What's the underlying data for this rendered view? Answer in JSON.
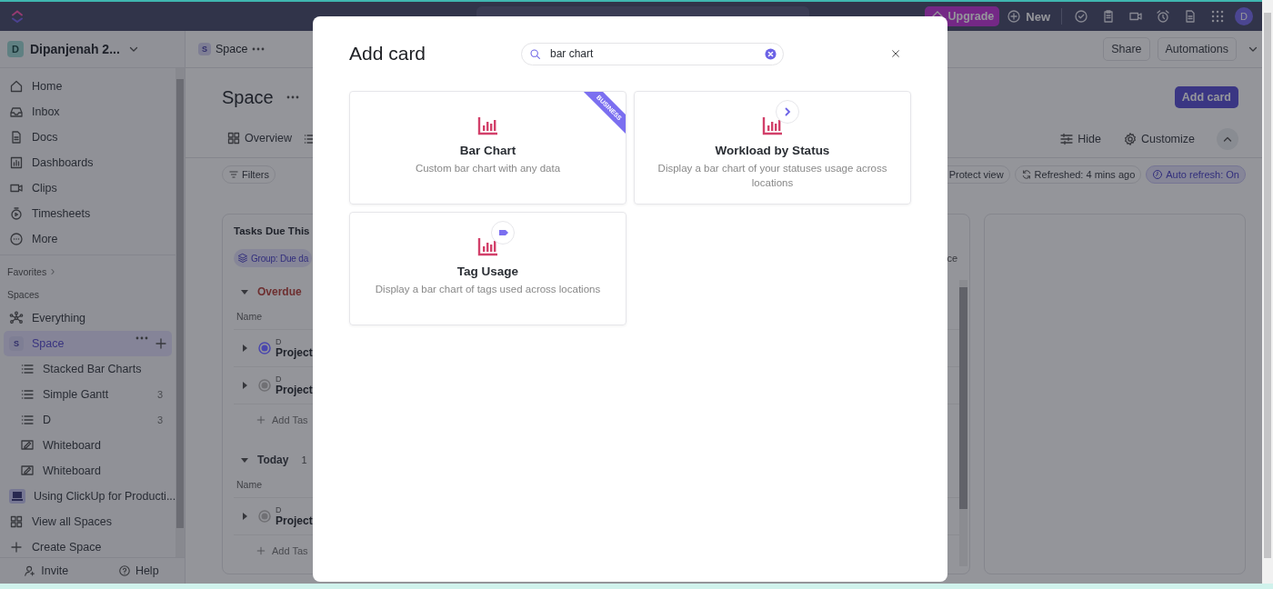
{
  "topbar": {
    "upgrade": "Upgrade",
    "new": "New",
    "avatar": "D"
  },
  "sidebar": {
    "workspace": {
      "initial": "D",
      "name": "Dipanjenah 2..."
    },
    "nav": [
      {
        "label": "Home",
        "kind": "home",
        "selected": false
      },
      {
        "label": "Inbox",
        "kind": "inbox",
        "selected": false
      },
      {
        "label": "Docs",
        "kind": "docs",
        "selected": false
      },
      {
        "label": "Dashboards",
        "kind": "dashboards",
        "selected": false
      },
      {
        "label": "Clips",
        "kind": "clips",
        "selected": false
      },
      {
        "label": "Timesheets",
        "kind": "timesheets",
        "selected": false
      },
      {
        "label": "More",
        "kind": "more",
        "selected": false
      }
    ],
    "favorites": "Favorites",
    "spaces_label": "Spaces",
    "spaces": [
      {
        "label": "Everything",
        "kind": "everything",
        "selected": false
      },
      {
        "label": "Space",
        "kind": "space",
        "initial": "S",
        "selected": true,
        "children": [
          {
            "label": "Stacked Bar Charts",
            "kind": "list",
            "selected": false
          },
          {
            "label": "Simple Gantt",
            "kind": "list",
            "count": "3",
            "selected": false
          },
          {
            "label": "D",
            "kind": "list",
            "count": "3",
            "selected": false
          },
          {
            "label": "Whiteboard",
            "kind": "whiteboard",
            "selected": false
          },
          {
            "label": "Whiteboard",
            "kind": "whiteboard",
            "selected": false
          }
        ]
      },
      {
        "label": "Using ClickUp for Producti...",
        "kind": "laptop",
        "selected": false
      },
      {
        "label": "View all Spaces",
        "kind": "grid",
        "selected": false
      },
      {
        "label": "Create Space",
        "kind": "create",
        "selected": false
      }
    ],
    "footer": [
      {
        "label": "Invite",
        "kind": "invite"
      },
      {
        "label": "Help",
        "kind": "help"
      }
    ]
  },
  "main": {
    "breadcrumb": {
      "initial": "S",
      "label": "Space"
    },
    "header_buttons": [
      "Share",
      "Automations"
    ],
    "title": "Space",
    "add_card": "Add card",
    "tabs": [
      {
        "label": "Overview",
        "selected": false
      }
    ],
    "view_actions": [
      {
        "label": "Hide",
        "kind": "sliders"
      },
      {
        "label": "Customize",
        "kind": "gear"
      }
    ],
    "filters": "Filters",
    "chips": [
      {
        "label": "Protect view",
        "kind": "shield",
        "on": false
      },
      {
        "label": "Refreshed: 4 mins ago",
        "kind": "refresh",
        "on": false
      },
      {
        "label": "Auto refresh: On",
        "kind": "clock",
        "on": true
      }
    ],
    "tasks_card": {
      "title": "Tasks Due This",
      "group": "Group: Due da",
      "fragment": "ce",
      "sections": [
        {
          "label": "Overdue",
          "kind": "overdue",
          "column": "Name",
          "add": "Add Tas",
          "rows": [
            {
              "tag": "D",
              "name": "Project",
              "color": "#4b48ae"
            },
            {
              "tag": "D",
              "name": "Project",
              "color": "#707074"
            }
          ]
        },
        {
          "label": "Today",
          "kind": "today",
          "count": "1",
          "column": "Name",
          "add": "Add Tas",
          "rows": [
            {
              "tag": "D",
              "name": "Project",
              "color": "#707074"
            }
          ]
        }
      ]
    }
  },
  "modal": {
    "title": "Add card",
    "search": {
      "value": "bar chart"
    },
    "cards": [
      {
        "title": "Bar Chart",
        "description": "Custom bar chart with any data",
        "kind": "plain",
        "ribbon": "BUSINESS"
      },
      {
        "title": "Workload by Status",
        "description": "Display a bar chart of your statuses usage across locations",
        "kind": "arrow"
      },
      {
        "title": "Tag Usage",
        "description": "Display a bar chart of tags used across locations",
        "kind": "tag"
      }
    ]
  }
}
